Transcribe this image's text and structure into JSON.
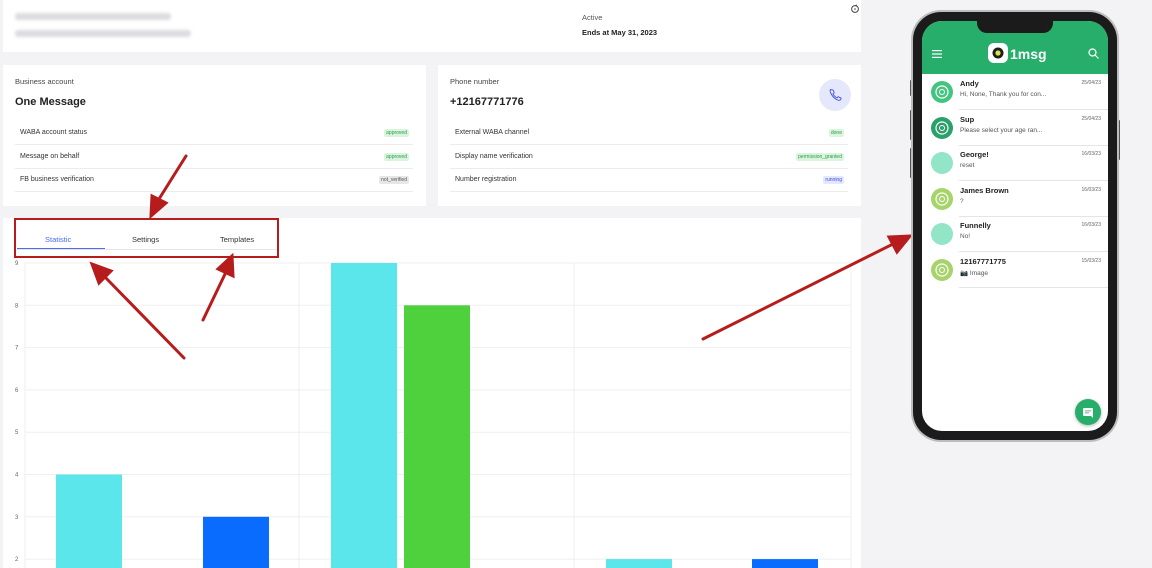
{
  "top": {
    "status": "Active",
    "ends": "Ends at May 31, 2023"
  },
  "business": {
    "label": "Business account",
    "name": "One Message",
    "rows": [
      {
        "label": "WABA account status",
        "badge": "approved"
      },
      {
        "label": "Message on behalf",
        "badge": "approved"
      },
      {
        "label": "FB business verification",
        "badge": "not_verified"
      }
    ]
  },
  "phone_card": {
    "label": "Phone number",
    "number": "+12167771776",
    "rows": [
      {
        "label": "External WABA channel",
        "badge": "done"
      },
      {
        "label": "Display name verification",
        "badge": "permission_granted"
      },
      {
        "label": "Number registration",
        "badge": "running"
      }
    ]
  },
  "tabs": [
    "Statistic",
    "Settings",
    "Templates"
  ],
  "chart_data": {
    "type": "bar",
    "yticks": [
      "9",
      "8",
      "7",
      "6",
      "5",
      "4",
      "3",
      "2"
    ],
    "series": [
      {
        "values": [
          4,
          9,
          2
        ],
        "color": "#5ae6ea"
      },
      {
        "values": [
          3,
          8,
          2
        ],
        "color": "#mixed"
      }
    ],
    "bars": [
      {
        "value": 4,
        "color": "#5ae6ea"
      },
      {
        "value": 3,
        "color": "#0a6cff"
      },
      {
        "value": 9,
        "color": "#5ae6ea"
      },
      {
        "value": 8,
        "color": "#4ed13c"
      },
      {
        "value": 2,
        "color": "#5ae6ea"
      },
      {
        "value": 2,
        "color": "#0a6cff"
      }
    ],
    "ylim_visible": [
      2,
      9
    ]
  },
  "app": {
    "logo": "1msg",
    "chats": [
      {
        "name": "Andy",
        "msg": "Hi, None, Thank you for con...",
        "date": "25/04/23",
        "avatar": "bot1"
      },
      {
        "name": "Sup",
        "msg": "Please select your age ran...",
        "date": "25/04/23",
        "avatar": "bot2"
      },
      {
        "name": "George!",
        "msg": "reset",
        "date": "16/03/23",
        "avatar": "plain"
      },
      {
        "name": "James Brown",
        "msg": "?",
        "date": "16/03/23",
        "avatar": "olive"
      },
      {
        "name": "Funnelly",
        "msg": "No!",
        "date": "16/03/23",
        "avatar": "plain"
      },
      {
        "name": "12167771775",
        "msg": "📷 Image",
        "date": "15/03/23",
        "avatar": "olive"
      }
    ]
  },
  "colors": {
    "accent": "#4a6cf7",
    "brand": "#27ae6a",
    "arrow": "#b71c1c"
  }
}
